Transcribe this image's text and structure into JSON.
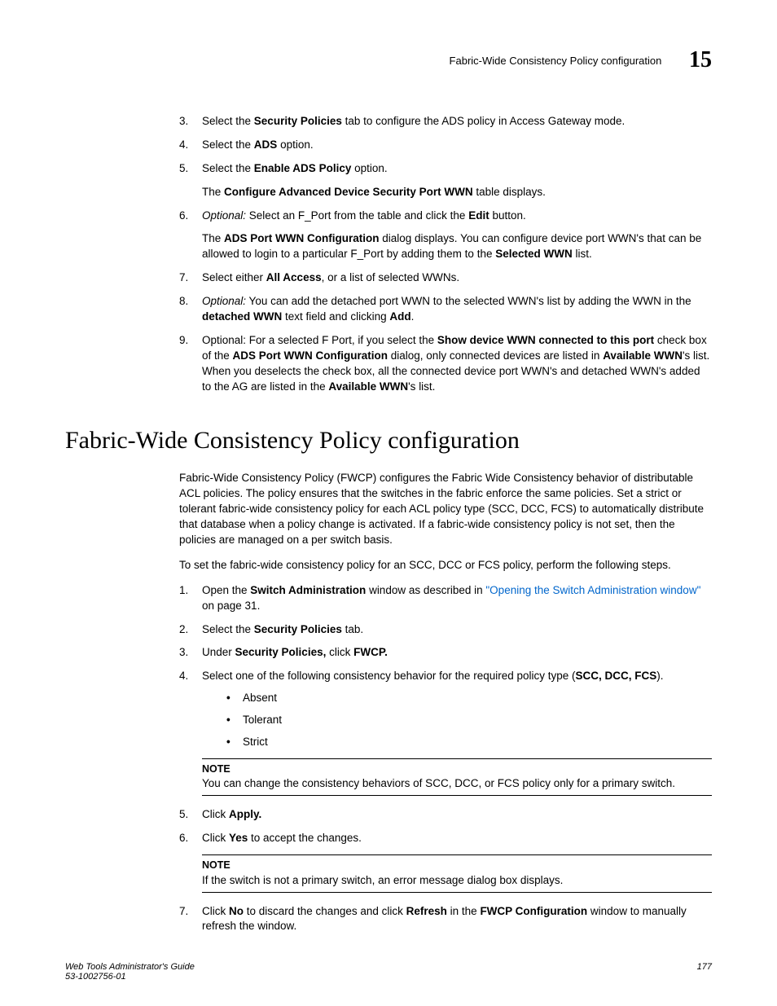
{
  "header": {
    "running_title": "Fabric-Wide Consistency Policy configuration",
    "chapter_number": "15"
  },
  "steps1": {
    "s3": {
      "num": "3.",
      "t1": "Select the ",
      "b1": "Security Policies",
      "t2": " tab to configure the ADS policy in Access Gateway mode."
    },
    "s4": {
      "num": "4.",
      "t1": "Select the ",
      "b1": "ADS",
      "t2": " option."
    },
    "s5": {
      "num": "5.",
      "t1": "Select the ",
      "b1": "Enable ADS Policy",
      "t2": " option.",
      "p1a": "The ",
      "p1b": "Configure Advanced Device Security Port WWN",
      "p1c": " table displays."
    },
    "s6": {
      "num": "6.",
      "opt": "Optional:",
      "t1": " Select an F_Port from the table and click the ",
      "b1": "Edit",
      "t2": " button.",
      "p1a": "The ",
      "p1b": "ADS Port WWN Configuration",
      "p1c": " dialog displays. You can configure device port WWN's that can be allowed to login to a particular F_Port by adding them to the ",
      "p1d": "Selected WWN",
      "p1e": " list."
    },
    "s7": {
      "num": "7.",
      "t1": "Select either ",
      "b1": "All Access",
      "t2": ", or a list of selected WWNs."
    },
    "s8": {
      "num": "8.",
      "opt": "Optional:",
      "t1": " You can add the detached port WWN to the selected WWN's list by adding the WWN in the ",
      "b1": "detached WWN",
      "t2": " text field and clicking ",
      "b2": "Add",
      "t3": "."
    },
    "s9": {
      "num": "9.",
      "t1": "Optional: For a selected F Port, if you select the ",
      "b1": "Show device WWN connected to this port",
      "t2": " check box of the ",
      "b2": "ADS Port WWN Configuration",
      "t3": " dialog, only connected devices are listed in ",
      "b3": "Available WWN",
      "t4": "'s list. When you deselects the check box, all the connected device port WWN's and detached WWN's added to the AG  are listed in the ",
      "b4": "Available WWN",
      "t5": "'s list."
    }
  },
  "section_heading": "Fabric-Wide Consistency Policy configuration",
  "intro": {
    "p1": "Fabric-Wide Consistency Policy (FWCP) configures the Fabric Wide Consistency behavior of distributable ACL policies. The policy ensures that the switches in the fabric enforce the same policies. Set a strict or tolerant fabric-wide consistency policy for each ACL policy type (SCC, DCC, FCS) to automatically distribute that database when a policy change is activated. If a fabric-wide consistency policy is not set, then the policies are managed on a per switch basis.",
    "p2": "To set the fabric-wide consistency policy for an SCC, DCC or FCS policy, perform the following steps."
  },
  "steps2": {
    "s1": {
      "num": "1.",
      "t1": "Open the ",
      "b1": "Switch Administration",
      "t2": " window as described in ",
      "link": "\"Opening the Switch Administration window\"",
      "t3": " on page 31."
    },
    "s2": {
      "num": "2.",
      "t1": "Select the ",
      "b1": "Security Policies",
      "t2": " tab."
    },
    "s3": {
      "num": "3.",
      "t1": "Under ",
      "b1": "Security Policies,",
      "t2": " click ",
      "b2": "FWCP."
    },
    "s4": {
      "num": "4.",
      "t1": "Select one of the following consistency behavior for the required policy type (",
      "b1": "SCC, DCC, FCS",
      "t2": ").",
      "bullets": [
        "Absent",
        "Tolerant",
        "Strict"
      ]
    },
    "note1": {
      "label": "NOTE",
      "body": "You can change the consistency behaviors of SCC, DCC, or FCS policy only for a primary switch."
    },
    "s5": {
      "num": "5.",
      "t1": "Click ",
      "b1": "Apply."
    },
    "s6": {
      "num": "6.",
      "t1": "Click ",
      "b1": "Yes",
      "t2": " to accept the changes."
    },
    "note2": {
      "label": "NOTE",
      "body": "If the switch is not a primary switch, an error message dialog box displays."
    },
    "s7": {
      "num": "7.",
      "t1": "Click ",
      "b1": "No",
      "t2": " to discard the changes and click ",
      "b2": "Refresh",
      "t3": " in the ",
      "b3": "FWCP Configuration",
      "t4": " window to manually refresh the window."
    }
  },
  "footer": {
    "left1": "Web Tools Administrator's Guide",
    "left2": "53-1002756-01",
    "right": "177"
  }
}
